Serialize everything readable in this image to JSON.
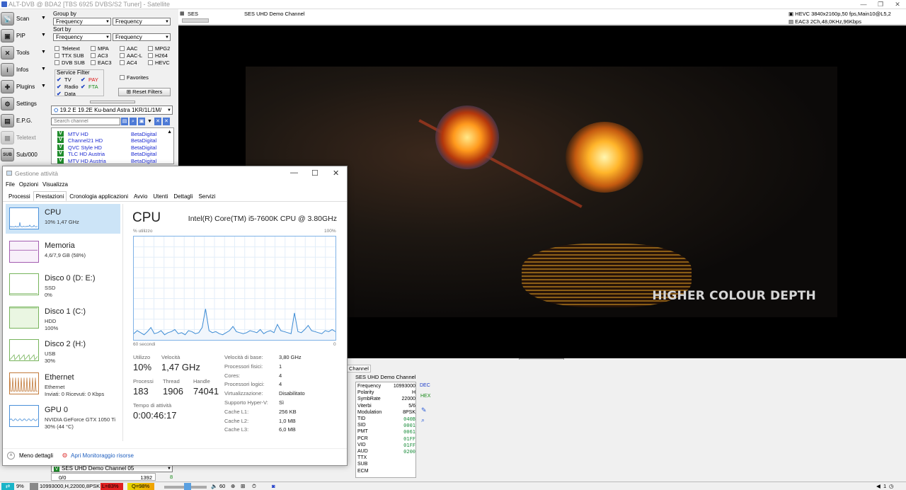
{
  "app": {
    "title": "ALT-DVB @ BDA2 [TBS 6925 DVBS/S2 Tuner] - Satellite",
    "window_buttons": [
      "—",
      "❐",
      "✕"
    ]
  },
  "leftbar": [
    {
      "label": "Scan",
      "icon": "scan-icon",
      "glyph": "📡",
      "arrow": "▼"
    },
    {
      "label": "PIP",
      "icon": "pip-icon",
      "glyph": "▣",
      "arrow": "▼"
    },
    {
      "label": "Tools",
      "icon": "tools-icon",
      "glyph": "✕",
      "arrow": "▼"
    },
    {
      "label": "Infos",
      "icon": "info-icon",
      "glyph": "i",
      "arrow": "▼"
    },
    {
      "label": "Plugins",
      "icon": "plugins-icon",
      "glyph": "✚",
      "arrow": "▼"
    },
    {
      "label": "Settings",
      "icon": "settings-icon",
      "glyph": "⚙",
      "arrow": ""
    },
    {
      "label": "E.P.G.",
      "icon": "epg-icon",
      "glyph": "▤",
      "arrow": ""
    },
    {
      "label": "Teletext",
      "icon": "teletext-icon",
      "glyph": "▦",
      "arrow": ""
    },
    {
      "label": "Sub/000",
      "icon": "sub-icon",
      "glyph": "SUB",
      "arrow": ""
    }
  ],
  "filters": {
    "group_by_label": "Group by",
    "group_by_1": "Frequency",
    "group_by_2": "Frequency",
    "sort_by_label": "Sort by",
    "sort_by_1": "Frequency",
    "sort_by_2": "Frequency",
    "checks": [
      [
        "Teletext",
        "MPA",
        "AAC",
        "MPG2"
      ],
      [
        "TTX SUB",
        "AC3",
        "AAC-L",
        "H264"
      ],
      [
        "DVB SUB",
        "EAC3",
        "AC4",
        "HEVC"
      ]
    ],
    "service_filter_label": "Service Filter",
    "service": {
      "tv": "TV",
      "pay": "PAY",
      "radio": "Radio",
      "fta": "FTA",
      "data": "Data"
    },
    "favorites": "Favorites",
    "reset": "Reset Filters",
    "satellite": "19.2 E 19.2E Ku-band Astra 1KR/1L/1M/",
    "search_placeholder": "Search channel"
  },
  "channels": [
    {
      "name": "MTV HD",
      "provider": "BetaDigital"
    },
    {
      "name": "Channel21 HD",
      "provider": "BetaDigital"
    },
    {
      "name": "QVC Style HD",
      "provider": "BetaDigital"
    },
    {
      "name": "TLC HD Austria",
      "provider": "BetaDigital"
    },
    {
      "name": "MTV HD Austria",
      "provider": "BetaDigital"
    }
  ],
  "video": {
    "header_channel_short": "SES",
    "header_channel": "SES UHD Demo Channel",
    "video_info": "HEVC 3840x2160p,50 fps,Main10@L5,2",
    "audio_info": "EAC3 2Ch,48,0KHz,96Kbps",
    "overlay_text": "HIGHER COLOUR DEPTH"
  },
  "bottom": {
    "channel_tab": "Channel",
    "sig_channel": "SES UHD Demo Channel",
    "selector": "SES UHD Demo Channel 05",
    "counter_left": "0/0",
    "counter_right": "1392",
    "counter_num": "8",
    "dec": "DEC",
    "hex": "HEX",
    "signal": [
      {
        "k": "Frequency",
        "v": "10993000",
        "g": false
      },
      {
        "k": "Polarity",
        "v": "H",
        "g": false
      },
      {
        "k": "SymbRate",
        "v": "22000",
        "g": false
      },
      {
        "k": "Viterbi",
        "v": "5/6",
        "g": false
      },
      {
        "k": "Modulation",
        "v": "8PSK",
        "g": false
      },
      {
        "k": "TID",
        "v": "040B",
        "g": true
      },
      {
        "k": "SID",
        "v": "0001",
        "g": true
      },
      {
        "k": "PMT",
        "v": "0061",
        "g": true
      },
      {
        "k": "PCR",
        "v": "01FF",
        "g": true
      },
      {
        "k": "VID",
        "v": "01FF",
        "g": true
      },
      {
        "k": "AUD",
        "v": "0200",
        "g": true
      },
      {
        "k": "TTX",
        "v": "",
        "g": false
      },
      {
        "k": "SUB",
        "v": "",
        "g": false
      },
      {
        "k": "ECM",
        "v": "",
        "g": false
      }
    ]
  },
  "statusbar": {
    "cpu": "9%",
    "tune": "10993000,H,22000,8PSK",
    "level": "L=83%",
    "quality": "Q=98%",
    "volume": "60",
    "right_num": "1"
  },
  "taskmgr": {
    "title": "Gestione attività",
    "menu": [
      "File",
      "Opzioni",
      "Visualizza"
    ],
    "tabs": [
      "Processi",
      "Prestazioni",
      "Cronologia applicazioni",
      "Avvio",
      "Utenti",
      "Dettagli",
      "Servizi"
    ],
    "active_tab": 1,
    "side": [
      {
        "name": "CPU",
        "s1": "10% 1,47 GHz",
        "s2": "",
        "color": "#4a90d9",
        "bg": "#ffffff"
      },
      {
        "name": "Memoria",
        "s1": "4,6/7,9 GB (58%)",
        "s2": "",
        "color": "#a35cb0",
        "bg": "#f8f0fa"
      },
      {
        "name": "Disco 0 (D: E:)",
        "s1": "SSD",
        "s2": "0%",
        "color": "#77b45c",
        "bg": "#ffffff"
      },
      {
        "name": "Disco 1 (C:)",
        "s1": "HDD",
        "s2": "100%",
        "color": "#77b45c",
        "bg": "#eaf6e2"
      },
      {
        "name": "Disco 2 (H:)",
        "s1": "USB",
        "s2": "30%",
        "color": "#77b45c",
        "bg": "#ffffff"
      },
      {
        "name": "Ethernet",
        "s1": "Ethernet",
        "s2": "Inviati: 0  Ricevuti: 0 Kbps",
        "color": "#c27a3a",
        "bg": "#ffffff"
      },
      {
        "name": "GPU 0",
        "s1": "NVIDIA GeForce GTX 1050 Ti",
        "s2": "30% (44 °C)",
        "color": "#4a90d9",
        "bg": "#ffffff"
      }
    ],
    "cpu_title": "CPU",
    "cpu_model": "Intel(R) Core(TM) i5-7600K CPU @ 3.80GHz",
    "graph_label_top": "% utilizzo",
    "graph_label_max": "100%",
    "graph_label_time": "60 secondi",
    "graph_label_min": "0",
    "cpu_history": [
      6,
      9,
      7,
      5,
      8,
      12,
      6,
      7,
      9,
      5,
      7,
      8,
      10,
      6,
      7,
      5,
      9,
      8,
      6,
      7,
      12,
      30,
      9,
      7,
      8,
      6,
      5,
      7,
      9,
      13,
      8,
      7,
      6,
      7,
      9,
      8,
      7,
      10,
      6,
      8,
      9,
      7,
      15,
      9,
      8,
      7,
      6,
      26,
      8,
      7,
      10,
      14,
      9,
      8,
      7,
      6,
      9,
      8,
      10,
      8
    ],
    "stats": {
      "util_l": "Utilizzo",
      "util_v": "10%",
      "speed_l": "Velocità",
      "speed_v": "1,47 GHz",
      "proc_l": "Processi",
      "proc_v": "183",
      "thr_l": "Thread",
      "thr_v": "1906",
      "hnd_l": "Handle",
      "hnd_v": "74041",
      "up_l": "Tempo di attività",
      "up_v": "0:00:46:17"
    },
    "specs": [
      {
        "k": "Velocità di base:",
        "v": "3,80 GHz"
      },
      {
        "k": "Processori fisici:",
        "v": "1"
      },
      {
        "k": "Cores:",
        "v": "4"
      },
      {
        "k": "Processori logici:",
        "v": "4"
      },
      {
        "k": "Virtualizzazione:",
        "v": "Disabilitato"
      },
      {
        "k": "Supporto Hyper-V:",
        "v": "Sì"
      },
      {
        "k": "Cache L1:",
        "v": "256 KB"
      },
      {
        "k": "Cache L2:",
        "v": "1,0 MB"
      },
      {
        "k": "Cache L3:",
        "v": "6,0 MB"
      }
    ],
    "less_details": "Meno dettagli",
    "resource_monitor": "Apri Monitoraggio risorse"
  }
}
